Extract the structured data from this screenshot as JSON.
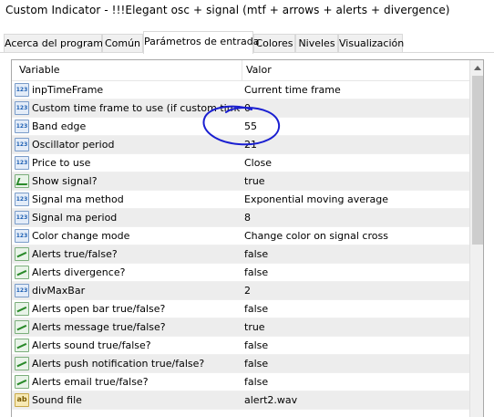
{
  "window": {
    "title": "Custom Indicator - !!!Elegant osc + signal (mtf + arrows + alerts + divergence)"
  },
  "tabs": [
    {
      "label": "Acerca del programa",
      "active": false
    },
    {
      "label": "Común",
      "active": false
    },
    {
      "label": "Parámetros de entrada",
      "active": true
    },
    {
      "label": "Colores",
      "active": false
    },
    {
      "label": "Niveles",
      "active": false
    },
    {
      "label": "Visualización",
      "active": false
    }
  ],
  "grid": {
    "columns": {
      "variable": "Variable",
      "value": "Valor"
    },
    "rows": [
      {
        "type": "num",
        "name": "inpTimeFrame",
        "value": "Current time frame"
      },
      {
        "type": "num",
        "name": "Custom time frame to use (if custom time fram...",
        "value": "0"
      },
      {
        "type": "num",
        "name": "Band edge",
        "value": "55"
      },
      {
        "type": "num",
        "name": "Oscillator period",
        "value": "21"
      },
      {
        "type": "num",
        "name": "Price to use",
        "value": "Close"
      },
      {
        "type": "bool",
        "name": "Show signal?",
        "value": "true"
      },
      {
        "type": "num",
        "name": "Signal ma method",
        "value": "Exponential moving average"
      },
      {
        "type": "num",
        "name": "Signal ma period",
        "value": "8"
      },
      {
        "type": "num",
        "name": "Color change mode",
        "value": "Change color on signal cross"
      },
      {
        "type": "enum",
        "name": "Alerts true/false?",
        "value": "false"
      },
      {
        "type": "enum",
        "name": "Alerts divergence?",
        "value": "false"
      },
      {
        "type": "num",
        "name": "divMaxBar",
        "value": "2"
      },
      {
        "type": "enum",
        "name": "Alerts open bar true/false?",
        "value": "false"
      },
      {
        "type": "enum",
        "name": "Alerts message true/false?",
        "value": "true"
      },
      {
        "type": "enum",
        "name": "Alerts sound true/false?",
        "value": "false"
      },
      {
        "type": "enum",
        "name": "Alerts push notification true/false?",
        "value": "false"
      },
      {
        "type": "enum",
        "name": "Alerts email true/false?",
        "value": "false"
      },
      {
        "type": "str",
        "name": "Sound file",
        "value": "alert2.wav"
      }
    ]
  },
  "colors": {
    "annotation_ink": "#1a1fd1",
    "alt_row": "#ededed"
  }
}
